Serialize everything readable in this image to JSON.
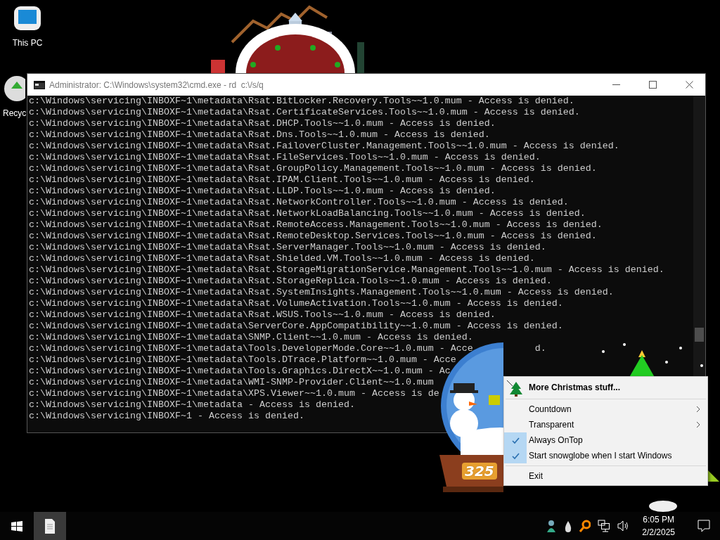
{
  "desktop_icons": [
    {
      "label": "This PC"
    },
    {
      "label": "Recyc"
    }
  ],
  "console_window": {
    "title": "Administrator: C:\\Windows\\system32\\cmd.exe - rd  c:\\/s/q",
    "lines": [
      {
        "text": "c:\\Windows\\servicing\\INBOXF~1\\metadata\\Rsat.BitLocker.Recovery.Tools~~1.0.mum - Access is denied."
      },
      {
        "text": "c:\\Windows\\servicing\\INBOXF~1\\metadata\\Rsat.CertificateServices.Tools~~1.0.mum - Access is denied."
      },
      {
        "text": "c:\\Windows\\servicing\\INBOXF~1\\metadata\\Rsat.DHCP.Tools~~1.0.mum - Access is denied."
      },
      {
        "text": "c:\\Windows\\servicing\\INBOXF~1\\metadata\\Rsat.Dns.Tools~~1.0.mum - Access is denied."
      },
      {
        "text": "c:\\Windows\\servicing\\INBOXF~1\\metadata\\Rsat.FailoverCluster.Management.Tools~~1.0.mum - Access is denied."
      },
      {
        "text": "c:\\Windows\\servicing\\INBOXF~1\\metadata\\Rsat.FileServices.Tools~~1.0.mum - Access is denied."
      },
      {
        "text": "c:\\Windows\\servicing\\INBOXF~1\\metadata\\Rsat.GroupPolicy.Management.Tools~~1.0.mum - Access is denied."
      },
      {
        "text": "c:\\Windows\\servicing\\INBOXF~1\\metadata\\Rsat.IPAM.Client.Tools~~1.0.mum - Access is denied."
      },
      {
        "text": "c:\\Windows\\servicing\\INBOXF~1\\metadata\\Rsat.LLDP.Tools~~1.0.mum - Access is denied."
      },
      {
        "text": "c:\\Windows\\servicing\\INBOXF~1\\metadata\\Rsat.NetworkController.Tools~~1.0.mum - Access is denied."
      },
      {
        "text": "c:\\Windows\\servicing\\INBOXF~1\\metadata\\Rsat.NetworkLoadBalancing.Tools~~1.0.mum - Access is denied."
      },
      {
        "text": "c:\\Windows\\servicing\\INBOXF~1\\metadata\\Rsat.RemoteAccess.Management.Tools~~1.0.mum - Access is denied."
      },
      {
        "text": "c:\\Windows\\servicing\\INBOXF~1\\metadata\\Rsat.RemoteDesktop.Services.Tools~~1.0.mum - Access is denied."
      },
      {
        "text": "c:\\Windows\\servicing\\INBOXF~1\\metadata\\Rsat.ServerManager.Tools~~1.0.mum - Access is denied."
      },
      {
        "text": "c:\\Windows\\servicing\\INBOXF~1\\metadata\\Rsat.Shielded.VM.Tools~~1.0.mum - Access is denied."
      },
      {
        "text": "c:\\Windows\\servicing\\INBOXF~1\\metadata\\Rsat.StorageMigrationService.Management.Tools~~1.0.mum - Access is denied."
      },
      {
        "text": "c:\\Windows\\servicing\\INBOXF~1\\metadata\\Rsat.StorageReplica.Tools~~1.0.mum - Access is denied."
      },
      {
        "text": "c:\\Windows\\servicing\\INBOXF~1\\metadata\\Rsat.SystemInsights.Management.Tools~~1.0.mum - Access is denied."
      },
      {
        "text": "c:\\Windows\\servicing\\INBOXF~1\\metadata\\Rsat.VolumeActivation.Tools~~1.0.mum - Access is denied."
      },
      {
        "text": "c:\\Windows\\servicing\\INBOXF~1\\metadata\\Rsat.WSUS.Tools~~1.0.mum - Access is denied."
      },
      {
        "text": "c:\\Windows\\servicing\\INBOXF~1\\metadata\\ServerCore.AppCompatibility~~1.0.mum - Access is denied."
      },
      {
        "text": "c:\\Windows\\servicing\\INBOXF~1\\metadata\\SNMP.Client~~1.0.mum - Access is denied."
      },
      {
        "text": "c:\\Windows\\servicing\\INBOXF~1\\metadata\\Tools.DeveloperMode.Core~~1.0.mum - Acce",
        "tail": "d."
      },
      {
        "text": "c:\\Windows\\servicing\\INBOXF~1\\metadata\\Tools.DTrace.Platform~~1.0.mum - Acce"
      },
      {
        "text": "c:\\Windows\\servicing\\INBOXF~1\\metadata\\Tools.Graphics.DirectX~~1.0.mum - Ac"
      },
      {
        "text": "c:\\Windows\\servicing\\INBOXF~1\\metadata\\WMI-SNMP-Provider.Client~~1.0.mum"
      },
      {
        "text": "c:\\Windows\\servicing\\INBOXF~1\\metadata\\XPS.Viewer~~1.0.mum - Access is de"
      },
      {
        "text": "c:\\Windows\\servicing\\INBOXF~1\\metadata - Access is denied."
      },
      {
        "text": "c:\\Windows\\servicing\\INBOXF~1 - Access is denied."
      }
    ]
  },
  "snowglobe": {
    "counter": "325"
  },
  "context_menu": {
    "groups": [
      [
        {
          "kind": "header",
          "label": "More Christmas stuff..."
        }
      ],
      [
        {
          "kind": "submenu",
          "label": "Countdown"
        },
        {
          "kind": "submenu",
          "label": "Transparent"
        },
        {
          "kind": "check",
          "label": "Always OnTop",
          "checked": true
        },
        {
          "kind": "check",
          "label": "Start snowglobe when I start Windows",
          "checked": true
        }
      ],
      [
        {
          "kind": "command",
          "label": "Exit"
        }
      ]
    ]
  },
  "taskbar": {
    "apps": [
      {
        "selected": true
      }
    ],
    "time": "6:05 PM",
    "date": "2/2/2025"
  }
}
